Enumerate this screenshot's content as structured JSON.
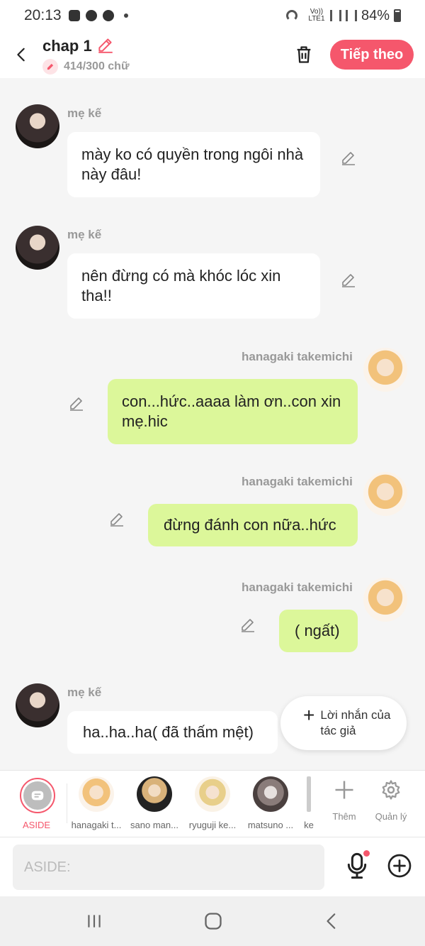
{
  "status": {
    "time": "20:13",
    "battery": "84%",
    "network": "Vo)) LTE1"
  },
  "header": {
    "title": "chap 1",
    "word_count": "414/300 chữ",
    "next_label": "Tiếp theo"
  },
  "messages": [
    {
      "sender": "mẹ kế",
      "text": "mày ko có quyền trong ngôi nhà này đâu!",
      "side": "left"
    },
    {
      "sender": "mẹ kế",
      "text": "nên đừng có mà khóc lóc xin tha!!",
      "side": "left"
    },
    {
      "sender": "hanagaki takemichi",
      "text": "con...hức..aaaa làm ơn..con xin mẹ.hic",
      "side": "right"
    },
    {
      "sender": "hanagaki takemichi",
      "text": "đừng đánh con nữa..hức",
      "side": "right"
    },
    {
      "sender": "hanagaki takemichi",
      "text": "( ngất)",
      "side": "right"
    },
    {
      "sender": "mẹ kế",
      "text": "ha..ha..ha( đã thấm mệt)",
      "side": "left"
    }
  ],
  "author_message": {
    "label": "Lời nhắn của tác giả"
  },
  "charbar": {
    "aside_label": "ASIDE",
    "characters": [
      {
        "label": "hanagaki t..."
      },
      {
        "label": "sano man..."
      },
      {
        "label": "ryuguji ke..."
      },
      {
        "label": "matsuno ..."
      },
      {
        "label": "ke"
      }
    ],
    "add_label": "Thêm",
    "manage_label": "Quản lý"
  },
  "input": {
    "placeholder": "ASIDE:"
  },
  "colors": {
    "accent": "#f5576c",
    "green_bubble": "#dcf79a",
    "white_bubble": "#ffffff"
  }
}
